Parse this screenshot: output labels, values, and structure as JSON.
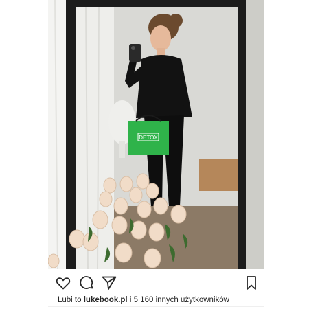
{
  "photo": {
    "bag_label": "DETOX"
  },
  "actions": {
    "like": "heart-icon",
    "comment": "comment-icon",
    "share": "send-icon",
    "save": "bookmark-icon"
  },
  "likes": {
    "prefix": "Lubi to",
    "user": "lukebook.pl",
    "suffix": "i 5 160 innych użytkowników"
  },
  "colors": {
    "bag_green": "#2fb34a",
    "wall": "#cdcdc8",
    "mirror_frame": "#1c1c1c",
    "rose": "#f1dcc8"
  }
}
